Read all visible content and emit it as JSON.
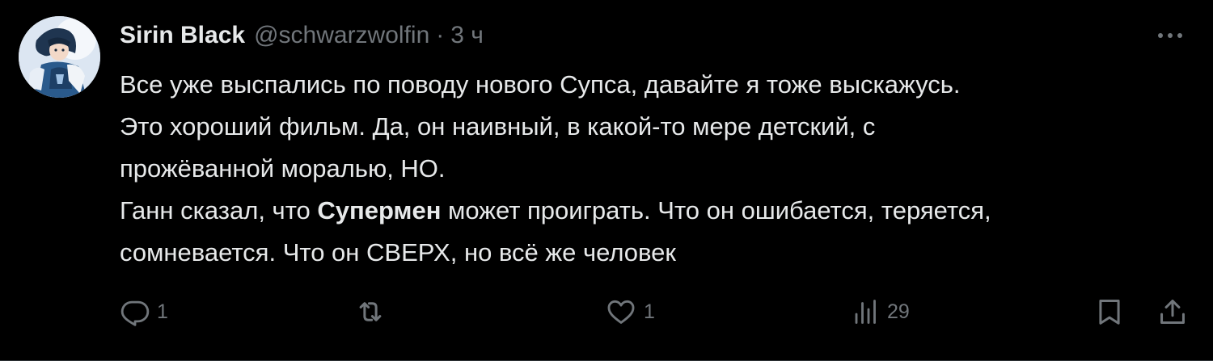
{
  "tweet": {
    "author": {
      "display_name": "Sirin Black",
      "handle": "@schwarzwolfin",
      "separator": "·",
      "time": "3 ч"
    },
    "text": {
      "line1": "Все уже выспались по поводу нового Супса, давайте я тоже выскажусь.",
      "line2": "Это хороший фильм. Да, он наивный, в какой-то мере детский, с",
      "line3": "прожёванной моралью, НО.",
      "line4_before": "Ганн сказал, что ",
      "line4_bold": "Супермен",
      "line4_after": " может проиграть. Что он ошибается, теряется,",
      "line5": "сомневается. Что он СВЕРХ, но всё же человек"
    },
    "actions": {
      "reply_count": "1",
      "retweet_count": "",
      "like_count": "1",
      "views_count": "29"
    },
    "icons": {
      "more": "more-icon",
      "reply": "reply-icon",
      "retweet": "retweet-icon",
      "like": "heart-icon",
      "views": "views-icon",
      "bookmark": "bookmark-icon",
      "share": "share-icon"
    },
    "colors": {
      "background": "#000000",
      "text": "#e7e9ea",
      "secondary": "#71767b",
      "border": "#2f3336"
    }
  }
}
